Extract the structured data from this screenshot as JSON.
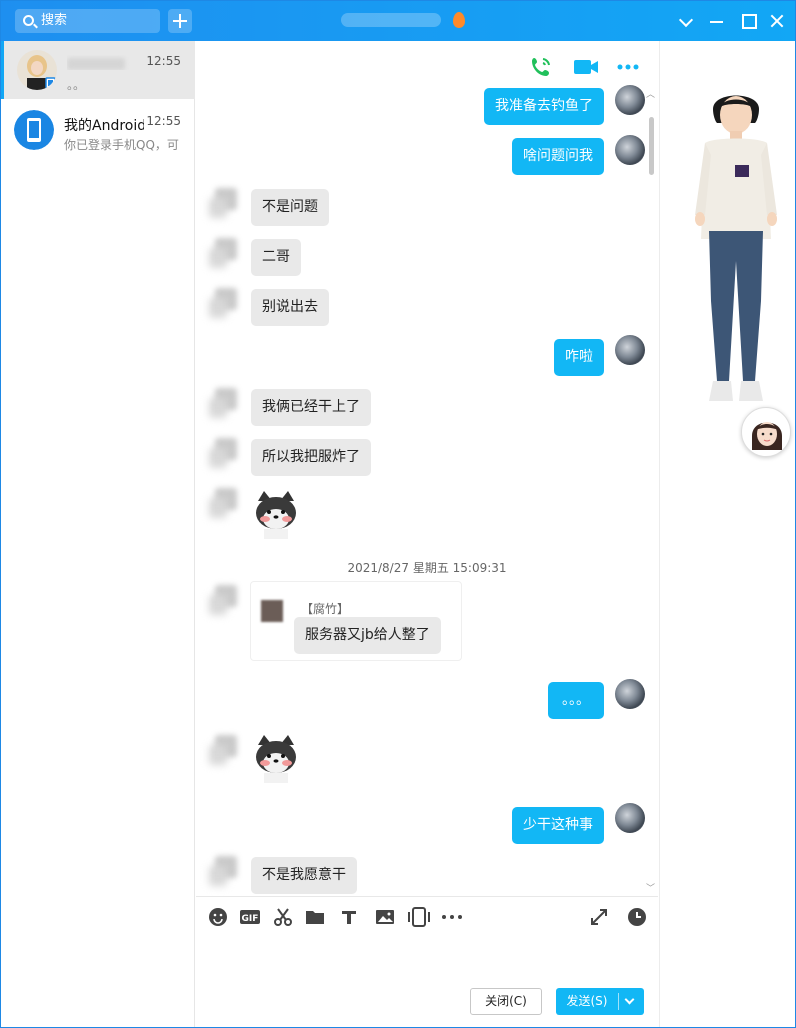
{
  "search": {
    "placeholder": "搜索"
  },
  "conversations": [
    {
      "name": "",
      "time": "12:55",
      "preview": "。。",
      "active": true
    },
    {
      "name": "我的Android手机",
      "time": "12:55",
      "preview": "你已登录手机QQ，可"
    }
  ],
  "messages": [
    {
      "side": "me",
      "text": "我准备去钓鱼了"
    },
    {
      "side": "me",
      "text": "啥问题问我"
    },
    {
      "side": "them",
      "text": "不是问题"
    },
    {
      "side": "them",
      "text": "二哥"
    },
    {
      "side": "them",
      "text": "别说出去"
    },
    {
      "side": "me",
      "text": "咋啦"
    },
    {
      "side": "them",
      "text": "我俩已经干上了"
    },
    {
      "side": "them",
      "text": "所以我把服炸了"
    },
    {
      "side": "them",
      "type": "sticker",
      "sticker": "shiba-dog-blush"
    },
    {
      "type": "timestamp",
      "text": "2021/8/27 星期五 15:09:31"
    },
    {
      "side": "them",
      "quote_label": "【腐竹】",
      "text": "服务器又jb给人整了"
    },
    {
      "side": "me",
      "text": "。。。"
    },
    {
      "side": "them",
      "type": "sticker",
      "sticker": "shiba-dog-blush"
    },
    {
      "side": "me",
      "text": "少干这种事"
    },
    {
      "side": "them",
      "text": "不是我愿意干"
    }
  ],
  "chat_header_icons": [
    "phone-call-icon",
    "video-call-icon",
    "more-icon"
  ],
  "toolbar_icons": [
    "emoji-icon",
    "gif-icon",
    "scissors-icon",
    "folder-icon",
    "music-icon",
    "image-icon",
    "screen-shake-icon",
    "more-icon",
    "expand-icon",
    "history-clock-icon"
  ],
  "buttons": {
    "close": "关闭(C)",
    "send": "发送(S)"
  },
  "colors": {
    "accent": "#12b7f5",
    "titlebar": "#1e8ff0",
    "bubble_them": "#e9e9e9"
  }
}
